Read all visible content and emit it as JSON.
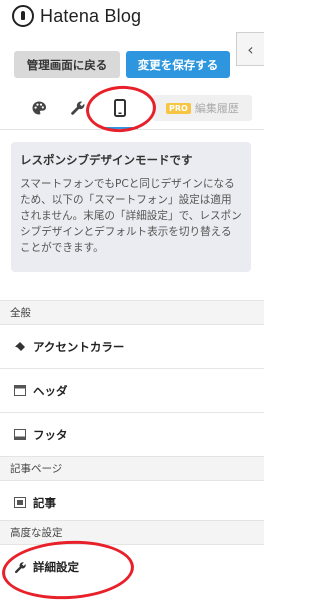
{
  "app": {
    "logo_text": "Hatena Blog"
  },
  "toolbar": {
    "back_label": "管理画面に戻る",
    "save_label": "変更を保存する",
    "collapse_glyph": "‹"
  },
  "tabs": {
    "items": [
      {
        "name": "design",
        "icon": "palette-icon"
      },
      {
        "name": "customize",
        "icon": "wrench-icon"
      },
      {
        "name": "smartphone",
        "icon": "smartphone-icon",
        "active": true
      }
    ],
    "history": {
      "badge": "PRO",
      "label": "編集履歴"
    }
  },
  "info": {
    "title": "レスポンシブデザインモードです",
    "body": "スマートフォンでもPCと同じデザインになるため、以下の「スマートフォン」設定は適用されません。末尾の「詳細設定」で、レスポンシブデザインとデフォルト表示を切り替えることができます。"
  },
  "sections": {
    "general": "全般",
    "article": "記事ページ",
    "advanced": "高度な設定"
  },
  "items": {
    "accent": "アクセントカラー",
    "header": "ヘッダ",
    "footer": "フッタ",
    "article": "記事",
    "advanced": "詳細設定"
  },
  "colors": {
    "accent": "#2d96df",
    "annotation": "#e8202a",
    "pro": "#f7c544"
  }
}
